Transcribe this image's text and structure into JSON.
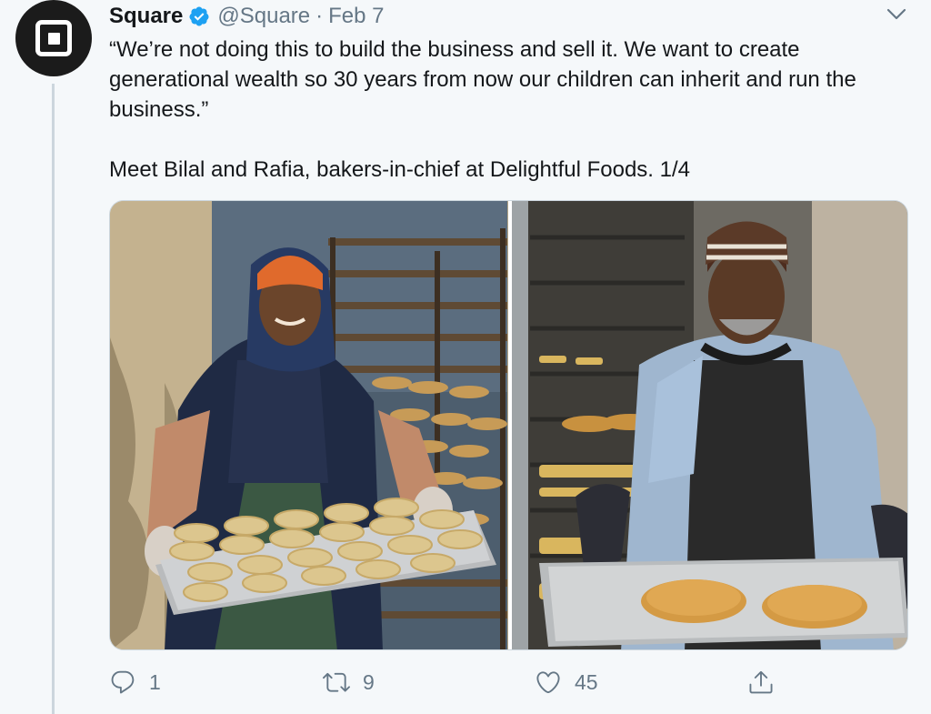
{
  "tweet": {
    "author_name": "Square",
    "handle": "@Square",
    "separator": "·",
    "date": "Feb 7",
    "text": "“We’re not doing this to build the business and sell it. We want to create generational wealth so 30 years from now our children can inherit and run the business.”\n\nMeet Bilal and Rafia, bakers-in-chief at Delightful Foods. 1/4",
    "verified_color": "#1da1f2"
  },
  "media": {
    "photos": [
      {
        "subject": "woman in orange headscarf holding tray of pies"
      },
      {
        "subject": "man in striped beanie holding tray of two pies"
      }
    ]
  },
  "actions": {
    "reply_count": "1",
    "retweet_count": "9",
    "like_count": "45"
  },
  "icons": [
    "avatar-logo",
    "verified-icon",
    "caret-down-icon",
    "reply-icon",
    "retweet-icon",
    "like-icon",
    "share-icon"
  ]
}
